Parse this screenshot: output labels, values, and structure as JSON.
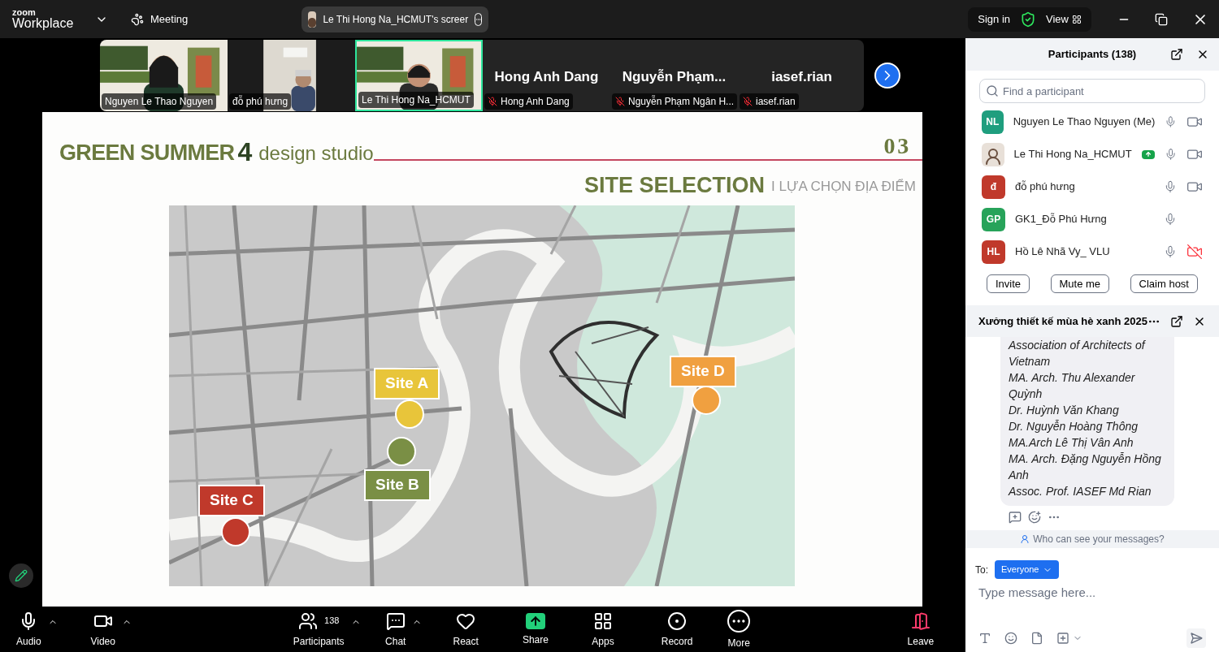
{
  "top_bar": {
    "logo_small": "zoom",
    "logo_big": "Workplace",
    "meeting_label": "Meeting",
    "share_title": "Le Thi Hong Na_HCMUT's screer",
    "sign_in": "Sign in",
    "view": "View"
  },
  "video_tiles": [
    {
      "kind": "video",
      "name": "Nguyen Le Thao Nguyen",
      "muted": false,
      "selected": false
    },
    {
      "kind": "video",
      "name": "đỗ phú hưng",
      "muted": false,
      "selected": false
    },
    {
      "kind": "video",
      "name": "Le Thi Hong Na_HCMUT",
      "muted": false,
      "selected": true
    },
    {
      "kind": "name",
      "title": "Hong Anh Dang",
      "name": "Hong Anh Dang",
      "muted": true,
      "selected": false
    },
    {
      "kind": "name",
      "title": "Nguyễn  Phạm...",
      "name": "Nguyễn Phạm Ngân H...",
      "muted": true,
      "selected": false
    },
    {
      "kind": "name",
      "title": "iasef.rian",
      "name": "iasef.rian",
      "muted": true,
      "selected": false
    }
  ],
  "slide": {
    "brand": "GREEN SUMMER",
    "brand_number": "4",
    "brand_tail": "design studio",
    "page_number": "03",
    "section": "SITE SELECTION",
    "section_sub": "I LỰA CHỌN ĐỊA ĐIỂM",
    "map": {
      "kind": "picture",
      "sites": [
        {
          "label": "Site A",
          "color": "#e8c53a"
        },
        {
          "label": "Site B",
          "color": "#7a8f45"
        },
        {
          "label": "Site C",
          "color": "#c0392b"
        },
        {
          "label": "Site D",
          "color": "#f0a040"
        }
      ]
    }
  },
  "participants": {
    "title": "Participants (138)",
    "search_placeholder": "Find a participant",
    "items": [
      {
        "kind": "initials",
        "initials": "NL",
        "color": "#1f9e7e",
        "name": "Nguyen Le Thao Nguyen (Me)",
        "sharing": false,
        "has_camera": true,
        "camera_off": false
      },
      {
        "kind": "picture",
        "name": "Le Thi Hong Na_HCMUT",
        "sharing": true,
        "has_camera": true,
        "camera_off": false
      },
      {
        "kind": "initials",
        "initials": "đ",
        "color": "#c0392b",
        "name": "đỗ phú hưng",
        "sharing": false,
        "has_camera": true,
        "camera_off": false
      },
      {
        "kind": "initials",
        "initials": "GP",
        "color": "#27a35a",
        "name": "GK1_Đỗ Phú Hưng",
        "sharing": false,
        "has_camera": false
      },
      {
        "kind": "initials",
        "initials": "HL",
        "color": "#c0392b",
        "name": "Hồ Lê Nhã Vy_ VLU",
        "sharing": false,
        "has_camera": true,
        "camera_off": true
      }
    ],
    "buttons": [
      "Invite",
      "Mute me",
      "Claim host"
    ]
  },
  "chat": {
    "title": "Xưởng thiết kế mùa hè xanh 2025",
    "message_lines": [
      "Association of Architects of Vietnam",
      "MA. Arch. Thu Alexander Quỳnh",
      "Dr. Huỳnh Văn Khang",
      "Dr. Nguyễn Hoàng Thông",
      "MA.Arch Lê Thị Vân Anh",
      "MA. Arch. Đặng Nguyễn Hồng Anh",
      "Assoc. Prof. IASEF Md Rian"
    ],
    "privacy_note": "Who can see your messages?",
    "to_label": "To:",
    "recipient": "Everyone",
    "input_placeholder": "Type message here..."
  },
  "toolbar": [
    {
      "kind": "audio",
      "label": "Audio",
      "caret": true
    },
    {
      "kind": "video",
      "label": "Video",
      "caret": true
    },
    {
      "kind": "participants",
      "label": "Participants",
      "count": "138",
      "caret": true
    },
    {
      "kind": "chat",
      "label": "Chat",
      "caret": true
    },
    {
      "kind": "react",
      "label": "React",
      "caret": false
    },
    {
      "kind": "share",
      "label": "Share",
      "caret": false
    },
    {
      "kind": "apps",
      "label": "Apps",
      "caret": false
    },
    {
      "kind": "record",
      "label": "Record",
      "caret": false
    },
    {
      "kind": "more",
      "label": "More",
      "caret": false
    },
    {
      "kind": "leave",
      "label": "Leave",
      "caret": false
    }
  ]
}
